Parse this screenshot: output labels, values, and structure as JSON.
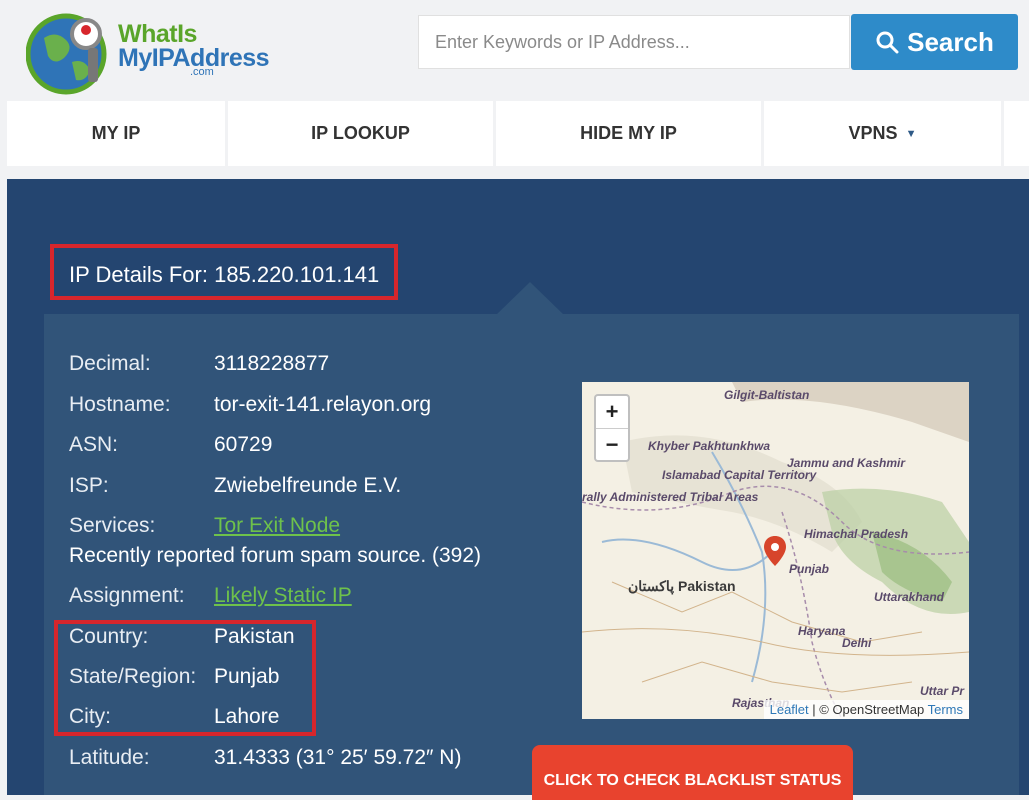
{
  "logo": {
    "line1": "WhatIs",
    "line2": "MyIPAddress",
    "suffix": ".com"
  },
  "search": {
    "placeholder": "Enter Keywords or IP Address...",
    "button_label": "Search"
  },
  "nav": {
    "items": [
      "MY IP",
      "IP LOOKUP",
      "HIDE MY IP",
      "VPNS"
    ]
  },
  "details": {
    "title": "IP Details For: 185.220.101.141",
    "rows": [
      {
        "label": "Decimal:",
        "value": "3118228877"
      },
      {
        "label": "Hostname:",
        "value": "tor-exit-141.relayon.org"
      },
      {
        "label": "ASN:",
        "value": "60729"
      },
      {
        "label": "ISP:",
        "value": "Zwiebelfreunde E.V."
      },
      {
        "label": "Services:",
        "value": "Tor Exit Node"
      },
      {
        "label": "",
        "value": "Recently reported forum spam source. (392)"
      },
      {
        "label": "Assignment:",
        "value": "Likely Static IP"
      },
      {
        "label": "Country:",
        "value": "Pakistan"
      },
      {
        "label": "State/Region:",
        "value": "Punjab"
      },
      {
        "label": "City:",
        "value": "Lahore"
      },
      {
        "label": "Latitude:",
        "value": "31.4333  (31° 25′ 59.72″ N)"
      }
    ]
  },
  "map": {
    "zoom_in": "+",
    "zoom_out": "−",
    "labels": [
      "Gilgit-Baltistan",
      "Khyber Pakhtunkhwa",
      "Jammu and Kashmir",
      "Islamabad Capital Territory",
      "rally Administered Tribal Areas",
      "Himachal Pradesh",
      "Punjab",
      "پاکستان Pakistan",
      "Uttarakhand",
      "Haryana",
      "Delhi",
      "Uttar Pr",
      "Rajasthan"
    ],
    "attribution": {
      "leaflet": "Leaflet",
      "sep": " | © OpenStreetMap ",
      "terms": "Terms"
    }
  },
  "blacklist_button": "CLICK TO CHECK BLACKLIST STATUS",
  "colors": {
    "accent": "#2e8bc9",
    "panel": "#244570",
    "highlight": "#d7262c",
    "link": "#6ec24b",
    "cta": "#e8432e"
  }
}
